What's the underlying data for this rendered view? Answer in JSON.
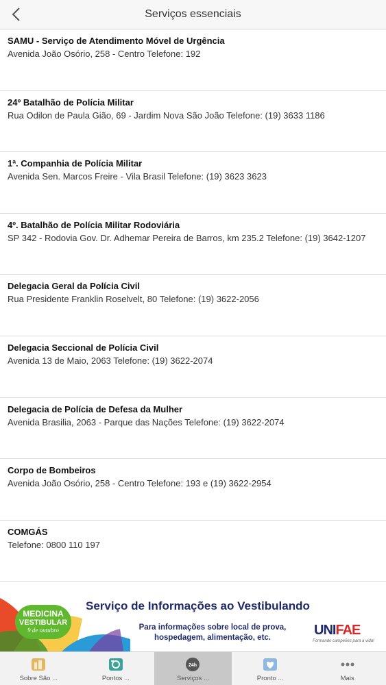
{
  "header": {
    "title": "Serviços essenciais"
  },
  "services": [
    {
      "name": "SAMU - Serviço de Atendimento Móvel de Urgência",
      "detail": "Avenida João Osório, 258 - Centro Telefone: 192"
    },
    {
      "name": "24º Batalhão de Polícia Militar",
      "detail": "Rua Odilon de Paula Gião, 69 - Jardim Nova São João Telefone: (19) 3633 1186"
    },
    {
      "name": "1ª. Companhia de Polícia Militar",
      "detail": "Avenida Sen. Marcos Freire - Vila Brasil Telefone: (19) 3623 3623"
    },
    {
      "name": "4º. Batalhão de Polícia Militar Rodoviária",
      "detail": "SP 342 - Rodovia Gov. Dr. Adhemar Pereira de Barros, km 235.2 Telefone: (19) 3642-1207"
    },
    {
      "name": "Delegacia Geral da Polícia Civil",
      "detail": "Rua Presidente Franklin Roselvelt, 80 Telefone: (19) 3622-2056"
    },
    {
      "name": "Delegacia Seccional de Polícia Civil",
      "detail": "Avenida 13 de Maio, 2063 Telefone: (19) 3622-2074"
    },
    {
      "name": "Delegacia de Polícia de Defesa da Mulher",
      "detail": "Avenida Brasilia, 2063 - Parque das Nações Telefone: (19) 3622-2074"
    },
    {
      "name": "Corpo de Bombeiros",
      "detail": "Avenida João Osório, 258 - Centro Telefone: 193 e (19) 3622-2954"
    },
    {
      "name": "COMGÁS",
      "detail": "Telefone: 0800 110 197"
    },
    {
      "name": "",
      "detail": ""
    }
  ],
  "banner": {
    "badge_line1": "MEDICINA",
    "badge_line2": "VESTIBULAR",
    "badge_line3": "9 de outubro",
    "title": "Serviço de Informações ao Vestibulando",
    "subtitle": "Para informações sobre local de prova, hospedagem, alimentação, etc.",
    "logo_uni": "UNI",
    "logo_fae": "FAE",
    "logo_tagline": "Formando campeões para a vida!",
    "colors": {
      "navy": "#1f2a6a",
      "green": "#5fb82e",
      "red": "#d42a2a"
    }
  },
  "tabbar": {
    "tabs": [
      {
        "label": "Sobre São ...",
        "icon": "city-icon",
        "active": false
      },
      {
        "label": "Pontos ...",
        "icon": "camera-icon",
        "active": false
      },
      {
        "label": "Serviços ...",
        "icon": "24h-icon",
        "active": true
      },
      {
        "label": "Pronto ...",
        "icon": "health-icon",
        "active": false
      },
      {
        "label": "Mais",
        "icon": "more-icon",
        "active": false
      }
    ]
  }
}
